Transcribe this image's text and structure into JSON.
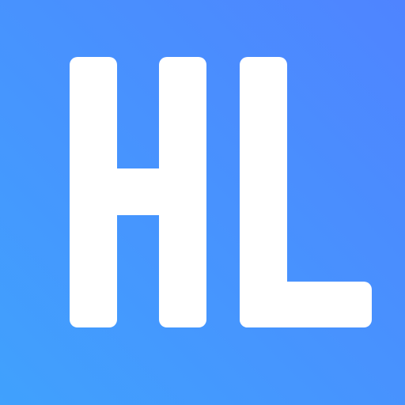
{
  "logo": {
    "monogram": "HL",
    "colors": {
      "background_start": "#40a1fd",
      "background_end": "#4f84ff",
      "letter": "#ffffff"
    }
  }
}
